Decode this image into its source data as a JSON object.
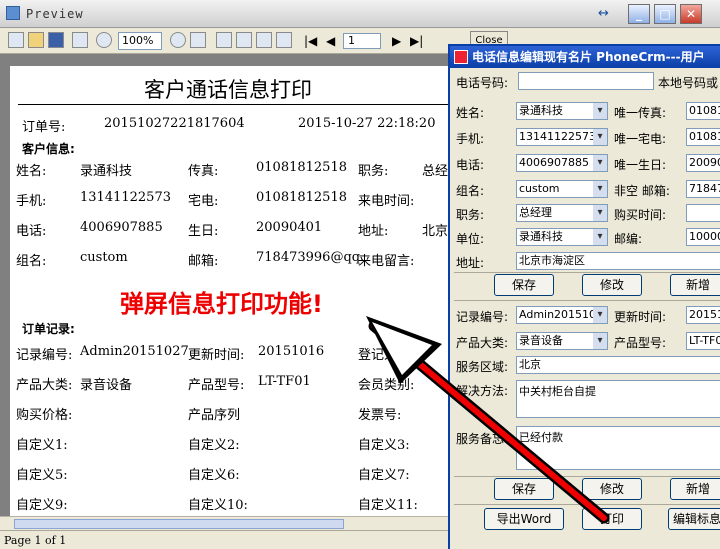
{
  "window": {
    "title": "Preview"
  },
  "toolbar": {
    "zoom": "100%",
    "page_input": "1",
    "close_label": "Close"
  },
  "document": {
    "title": "客户通话信息打印",
    "order_label": "订单号:",
    "order_no": "20151027221817604",
    "datetime": "2015-10-27 22:18:20",
    "customer_section": "客户信息:",
    "fields": [
      {
        "label": "姓名:",
        "value": "录通科技"
      },
      {
        "label": "传真:",
        "value": "01081812518"
      },
      {
        "label": "职务:",
        "value": "总经"
      },
      {
        "label": "手机:",
        "value": "13141122573"
      },
      {
        "label": "宅电:",
        "value": "01081812518"
      },
      {
        "label": "来电时间:",
        "value": ""
      },
      {
        "label": "电话:",
        "value": "4006907885"
      },
      {
        "label": "生日:",
        "value": "20090401"
      },
      {
        "label": "地址:",
        "value": "北京"
      },
      {
        "label": "组名:",
        "value": "custom"
      },
      {
        "label": "邮箱:",
        "value": "718473996@qq."
      },
      {
        "label": "来电留言:",
        "value": ""
      }
    ],
    "order_section": "订单记录:",
    "order_fields": [
      {
        "label": "记录编号:",
        "value": "Admin20151027"
      },
      {
        "label": "更新时间:",
        "value": "20151016"
      },
      {
        "label": "登记人:",
        "value": ""
      },
      {
        "label": "产品大类:",
        "value": "录音设备"
      },
      {
        "label": "产品型号:",
        "value": "LT-TF01"
      },
      {
        "label": "会员类别:",
        "value": ""
      },
      {
        "label": "购买价格:",
        "value": ""
      },
      {
        "label": "产品序列",
        "value": ""
      },
      {
        "label": "发票号:",
        "value": ""
      },
      {
        "label": "自定义1:",
        "value": ""
      },
      {
        "label": "自定义2:",
        "value": ""
      },
      {
        "label": "自定义3:",
        "value": ""
      },
      {
        "label": "自定义5:",
        "value": ""
      },
      {
        "label": "自定义6:",
        "value": ""
      },
      {
        "label": "自定义7:",
        "value": ""
      },
      {
        "label": "自定义9:",
        "value": ""
      },
      {
        "label": "自定义10:",
        "value": ""
      },
      {
        "label": "自定义11:",
        "value": ""
      }
    ]
  },
  "status": {
    "page_text": "Page 1 of 1"
  },
  "annotation": {
    "text": "弹屏信息打印功能!"
  },
  "dialog": {
    "title": "电话信息编辑现有名片    PhoneCrm---用户",
    "phone_label": "电话号码:",
    "phone_value": "",
    "local_label": "本地号码或",
    "name_label": "姓名:",
    "name_value": "录通科技",
    "fax_label": "唯一传真:",
    "fax_value": "010818",
    "mobile_label": "手机:",
    "mobile_value": "13141122573",
    "home_label": "唯一宅电:",
    "home_value": "010818",
    "tel_label": "电话:",
    "tel_value": "4006907885",
    "bday_label": "唯一生日:",
    "bday_value": "200904",
    "group_label": "组名:",
    "group_value": "custom",
    "email_label": "非空 邮箱:",
    "email_value": "718473",
    "job_label": "职务:",
    "job_value": "总经理",
    "buy_label": "购买时间:",
    "buy_value": "",
    "unit_label": "单位:",
    "unit_value": "录通科技",
    "zip_label": "邮编:",
    "zip_value": "100000",
    "addr_label": "地址:",
    "addr_value": "北京市海淀区",
    "save1": "保存",
    "edit1": "修改",
    "add1": "新增",
    "rec_label": "记录编号:",
    "rec_value": "Admin2015102",
    "upd_label": "更新时间:",
    "upd_value": "201510",
    "cat_label": "产品大类:",
    "cat_value": "录音设备",
    "model_label": "产品型号:",
    "model_value": "LT-TF0",
    "area_label": "服务区域:",
    "area_value": "北京",
    "solve_label": "解决方法:",
    "solve_value": "中关村柜台自提",
    "note_label": "服务备忘:",
    "note_value": "已经付款",
    "save2": "保存",
    "edit2": "修改",
    "add2": "新增",
    "word_label": "导出Word",
    "print_label": "打印",
    "editlbl_label": "编辑标息"
  },
  "colors": {
    "title_blue": "#0a3fa8",
    "annotation_red": "#e00000"
  }
}
